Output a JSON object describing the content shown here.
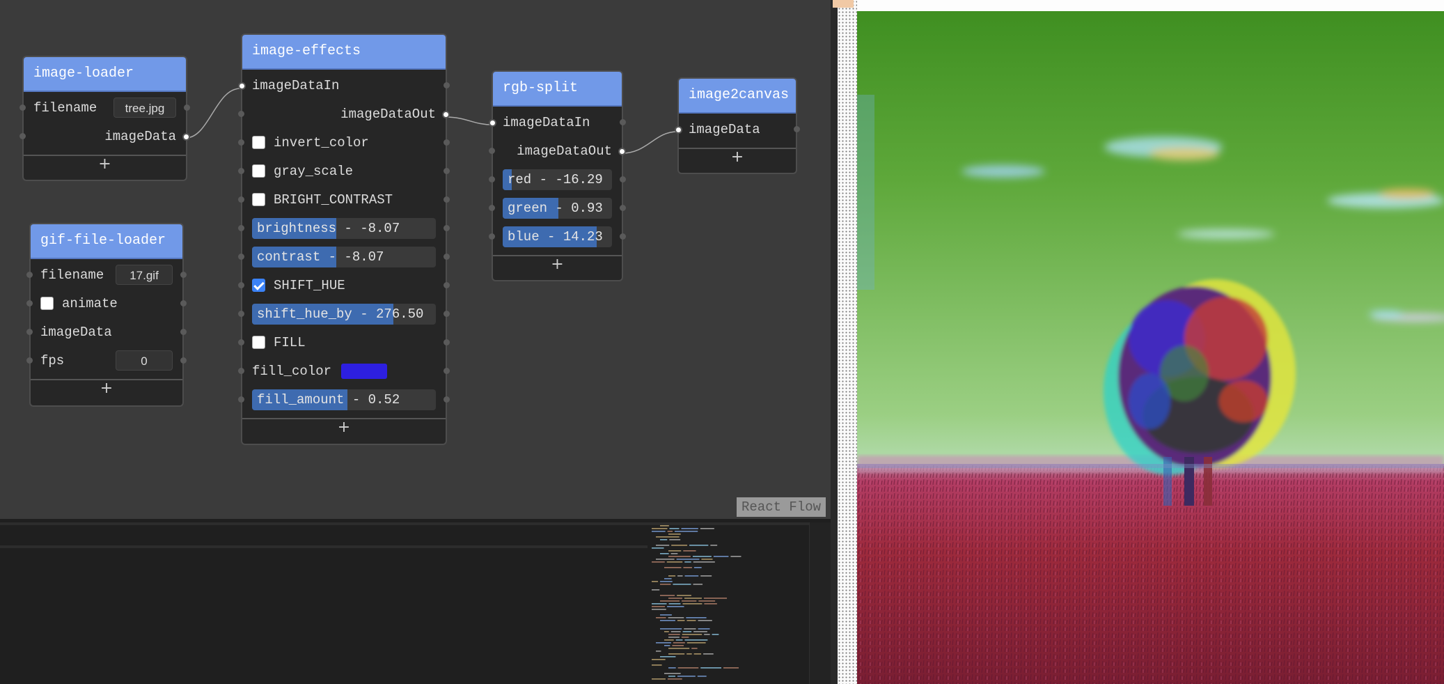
{
  "nodes": {
    "image_loader": {
      "title": "image-loader",
      "filename_label": "filename",
      "filename_value": "tree.jpg",
      "output_label": "imageData",
      "add": "+"
    },
    "gif_file_loader": {
      "title": "gif-file-loader",
      "filename_label": "filename",
      "filename_value": "17.gif",
      "animate_label": "animate",
      "animate_checked": false,
      "output_label": "imageData",
      "fps_label": "fps",
      "fps_value": "0",
      "add": "+"
    },
    "image_effects": {
      "title": "image-effects",
      "input_label": "imageDataIn",
      "output_label": "imageDataOut",
      "invert_color": "invert_color",
      "gray_scale": "gray_scale",
      "bright_contrast": "BRIGHT_CONTRAST",
      "brightness": "brightness - -8.07",
      "brightness_fraction": 0.46,
      "contrast": "contrast - -8.07",
      "contrast_fraction": 0.46,
      "shift_hue": "SHIFT_HUE",
      "shift_hue_checked": true,
      "shift_hue_by": "shift_hue_by - 276.50",
      "shift_hue_by_fraction": 0.77,
      "fill": "FILL",
      "fill_color_label": "fill_color",
      "fill_color": "#2d1fe0",
      "fill_amount": "fill_amount - 0.52",
      "fill_amount_fraction": 0.52,
      "add": "+"
    },
    "rgb_split": {
      "title": "rgb-split",
      "input_label": "imageDataIn",
      "output_label": "imageDataOut",
      "red": "red - -16.29",
      "red_fraction": 0.08,
      "green": "green - 0.93",
      "green_fraction": 0.51,
      "blue": "blue - 14.23",
      "blue_fraction": 0.86,
      "add": "+"
    },
    "image2canvas": {
      "title": "image2canvas",
      "input_label": "imageData",
      "add": "+"
    }
  },
  "attribution": "React Flow",
  "colors": {
    "node_header": "#7199e8",
    "slider_fill": "#3e6bb0",
    "checkbox_on": "#3b82f6"
  }
}
